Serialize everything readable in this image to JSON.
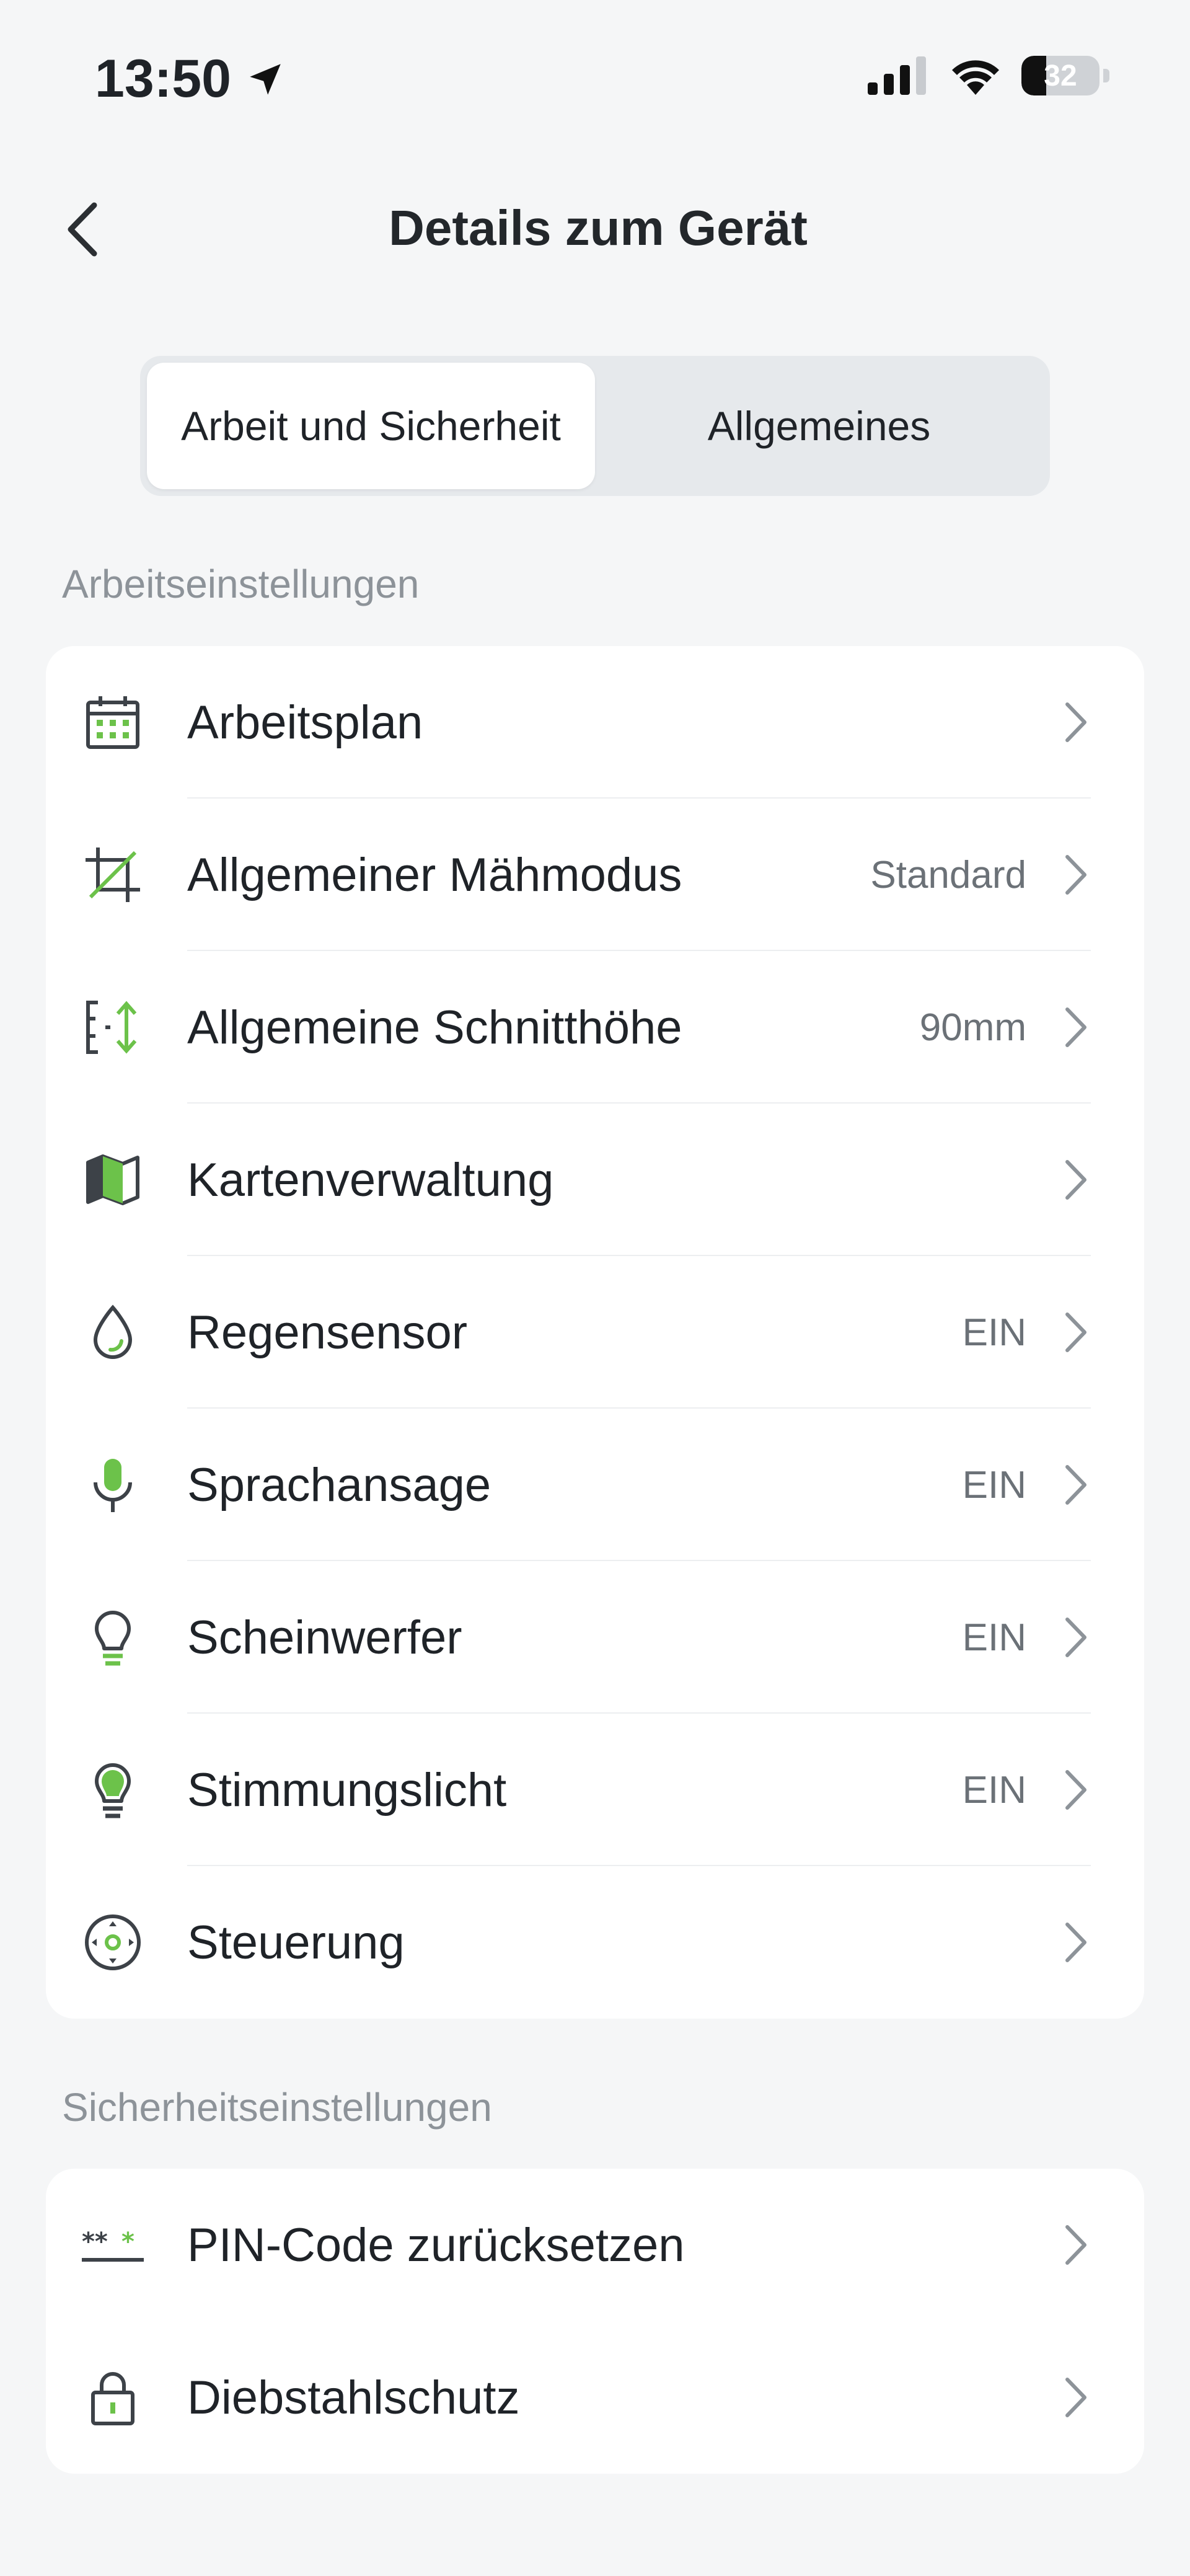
{
  "status": {
    "time": "13:50",
    "battery": "32",
    "battery_level": 0.32
  },
  "header": {
    "title": "Details zum Gerät"
  },
  "tabs": [
    {
      "label": "Arbeit und Sicherheit",
      "active": true
    },
    {
      "label": "Allgemeines",
      "active": false
    }
  ],
  "work_section": {
    "title": "Arbeitseinstellungen",
    "items": [
      {
        "label": "Arbeitsplan",
        "value": "",
        "icon": "calendar-icon"
      },
      {
        "label": "Allgemeiner Mähmodus",
        "value": "Standard",
        "icon": "crop-icon"
      },
      {
        "label": "Allgemeine Schnitthöhe",
        "value": "90mm",
        "icon": "height-icon"
      },
      {
        "label": "Kartenverwaltung",
        "value": "",
        "icon": "map-icon"
      },
      {
        "label": "Regensensor",
        "value": "EIN",
        "icon": "drop-icon"
      },
      {
        "label": "Sprachansage",
        "value": "EIN",
        "icon": "microphone-icon"
      },
      {
        "label": "Scheinwerfer",
        "value": "EIN",
        "icon": "bulb-icon"
      },
      {
        "label": "Stimmungslicht",
        "value": "EIN",
        "icon": "bulb-filled-icon"
      },
      {
        "label": "Steuerung",
        "value": "",
        "icon": "joystick-icon"
      }
    ]
  },
  "security_section": {
    "title": "Sicherheitseinstellungen",
    "items": [
      {
        "label": "PIN-Code zurücksetzen",
        "value": "",
        "icon": "pin-code-icon"
      },
      {
        "label": "Diebstahlschutz",
        "value": "",
        "icon": "lock-icon"
      }
    ]
  },
  "colors": {
    "accent": "#6cc24a",
    "icon": "#3d4248",
    "muted": "#8d9399"
  }
}
